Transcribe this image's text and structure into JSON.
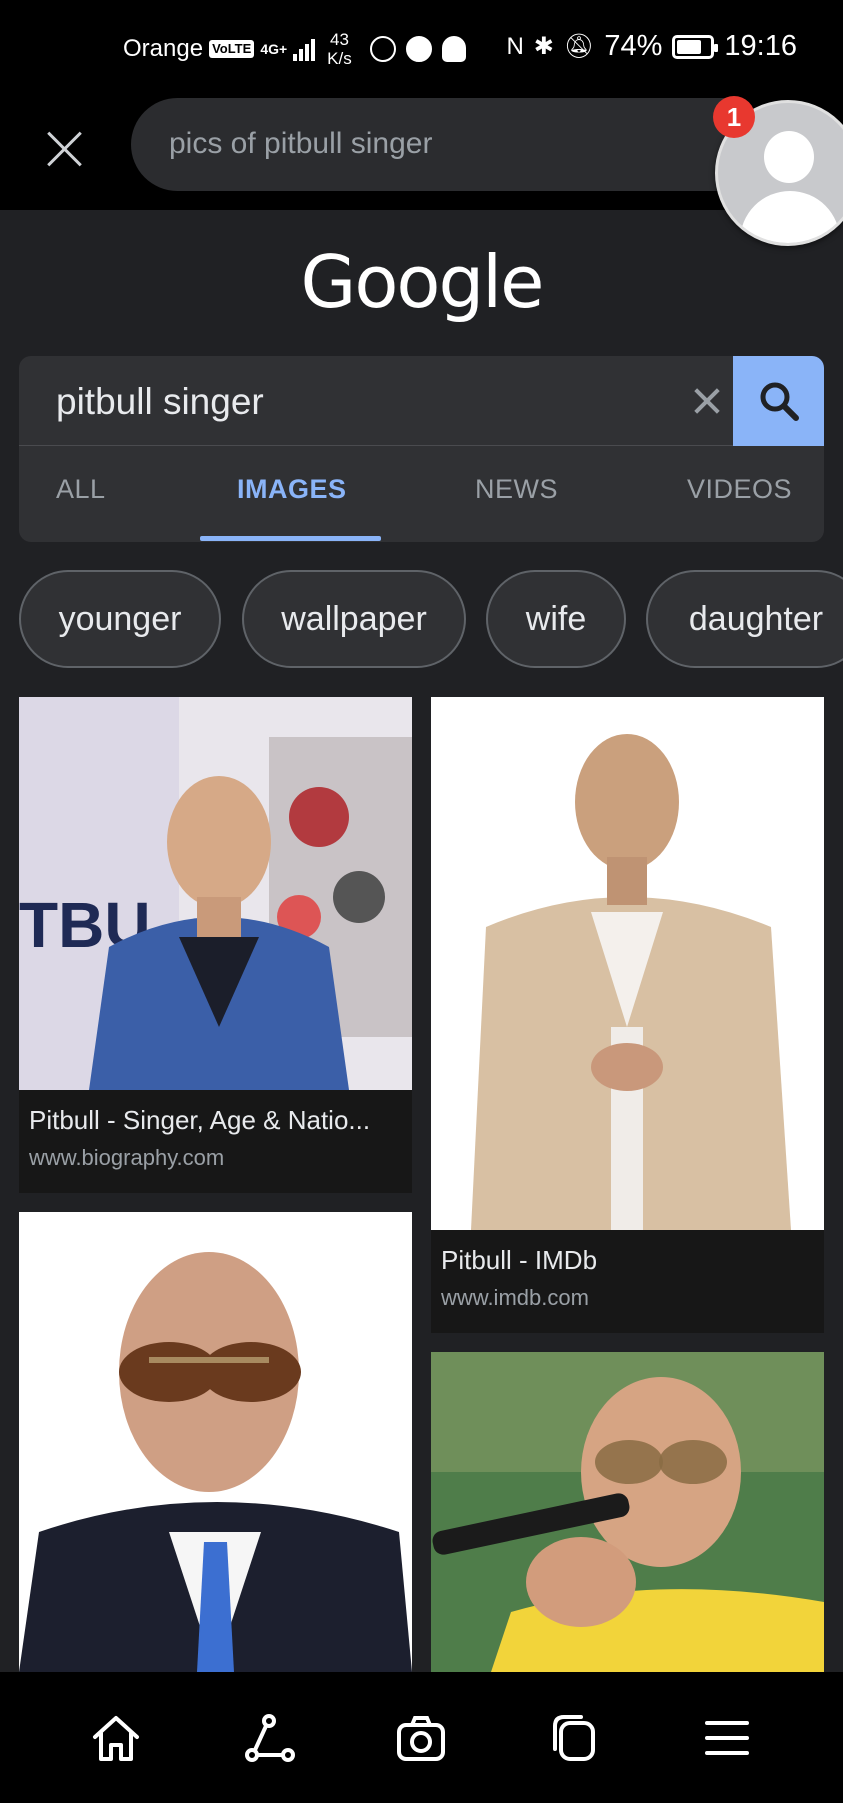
{
  "status_bar": {
    "carrier": "Orange",
    "volte": "VoLTE",
    "network": "4G+",
    "speed_value": "43",
    "speed_unit": "K/s",
    "battery": "74%",
    "time": "19:16"
  },
  "browser": {
    "url_text": "pics of pitbull singer",
    "notification_count": "1"
  },
  "page": {
    "logo": "Google",
    "search": {
      "query": "pitbull singer"
    },
    "tabs": [
      {
        "label": "ALL"
      },
      {
        "label": "IMAGES",
        "active": true
      },
      {
        "label": "NEWS"
      },
      {
        "label": "VIDEOS"
      }
    ],
    "chips": [
      "younger",
      "wallpaper",
      "wife",
      "daughter"
    ],
    "results": [
      {
        "title": "Pitbull - Singer, Age & Natio...",
        "source": "www.biography.com"
      },
      {
        "title": "Pitbull - IMDb",
        "source": "www.imdb.com"
      }
    ]
  },
  "colors": {
    "accent": "#8ab4f8",
    "page_bg": "#202124",
    "card_bg": "#303134",
    "badge": "#e8382f"
  }
}
